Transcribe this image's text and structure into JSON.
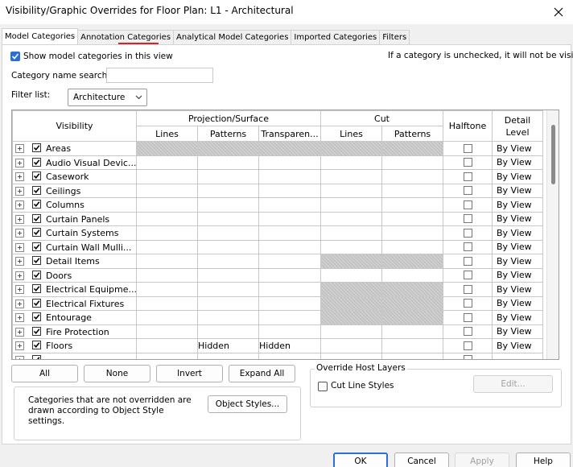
{
  "window": {
    "title": "Visibility/Graphic Overrides for Floor Plan: L1 - Architectural"
  },
  "tabs": [
    {
      "label": "Model Categories",
      "active": true
    },
    {
      "label": "Annotation Categories",
      "active": false
    },
    {
      "label": "Analytical Model Categories",
      "active": false
    },
    {
      "label": "Imported Categories",
      "active": false
    },
    {
      "label": "Filters",
      "active": false
    }
  ],
  "options": {
    "show_model_label": "Show model categories in this view",
    "show_model_checked": true,
    "hint": "If a category is unchecked, it will not be visible.",
    "search_label": "Category name search:",
    "search_value": "",
    "filter_label": "Filter list:",
    "filter_value": "Architecture"
  },
  "grid": {
    "headers": {
      "visibility": "Visibility",
      "projection": "Projection/Surface",
      "cut": "Cut",
      "halftone": "Halftone",
      "detail_level": "Detail Level",
      "lines": "Lines",
      "patterns": "Patterns",
      "transparency": "Transparen...",
      "cut_lines": "Lines",
      "cut_patterns": "Patterns"
    },
    "rows": [
      {
        "name": "Areas",
        "checked": true,
        "proj_grey": true,
        "cut_grey": true,
        "pat1": "",
        "pat2": "",
        "detail": "By View"
      },
      {
        "name": "Audio Visual Devic...",
        "checked": true,
        "proj_grey": false,
        "cut_grey": false,
        "pat1": "",
        "pat2": "",
        "detail": "By View"
      },
      {
        "name": "Casework",
        "checked": true,
        "proj_grey": false,
        "cut_grey": false,
        "pat1": "",
        "pat2": "",
        "detail": "By View"
      },
      {
        "name": "Ceilings",
        "checked": true,
        "proj_grey": false,
        "cut_grey": false,
        "pat1": "",
        "pat2": "",
        "detail": "By View"
      },
      {
        "name": "Columns",
        "checked": true,
        "proj_grey": false,
        "cut_grey": false,
        "pat1": "",
        "pat2": "",
        "detail": "By View"
      },
      {
        "name": "Curtain Panels",
        "checked": true,
        "proj_grey": false,
        "cut_grey": false,
        "pat1": "",
        "pat2": "",
        "detail": "By View"
      },
      {
        "name": "Curtain Systems",
        "checked": true,
        "proj_grey": false,
        "cut_grey": false,
        "pat1": "",
        "pat2": "",
        "detail": "By View"
      },
      {
        "name": "Curtain Wall Mulli...",
        "checked": true,
        "proj_grey": false,
        "cut_grey": false,
        "pat1": "",
        "pat2": "",
        "detail": "By View"
      },
      {
        "name": "Detail Items",
        "checked": true,
        "proj_grey": false,
        "cut_grey": true,
        "pat1": "",
        "pat2": "",
        "detail": "By View"
      },
      {
        "name": "Doors",
        "checked": true,
        "proj_grey": false,
        "cut_grey": false,
        "pat1": "",
        "pat2": "",
        "detail": "By View"
      },
      {
        "name": "Electrical Equipme...",
        "checked": true,
        "proj_grey": false,
        "cut_grey": true,
        "pat1": "",
        "pat2": "",
        "detail": "By View"
      },
      {
        "name": "Electrical Fixtures",
        "checked": true,
        "proj_grey": false,
        "cut_grey": true,
        "pat1": "",
        "pat2": "",
        "detail": "By View"
      },
      {
        "name": "Entourage",
        "checked": true,
        "proj_grey": false,
        "cut_grey": true,
        "pat1": "",
        "pat2": "",
        "detail": "By View"
      },
      {
        "name": "Fire Protection",
        "checked": true,
        "proj_grey": false,
        "cut_grey": false,
        "pat1": "",
        "pat2": "",
        "detail": "By View"
      },
      {
        "name": "Floors",
        "checked": true,
        "proj_grey": false,
        "cut_grey": false,
        "pat1": "Hidden",
        "pat2": "Hidden",
        "detail": "By View"
      },
      {
        "name": "",
        "checked": true,
        "proj_grey": false,
        "cut_grey": false,
        "pat1": "",
        "pat2": "",
        "detail": ""
      }
    ]
  },
  "actions": {
    "all": "All",
    "none": "None",
    "invert": "Invert",
    "expand_all": "Expand All",
    "object_styles_note": "Categories that are not overridden are drawn according to Object Style settings.",
    "object_styles": "Object Styles..."
  },
  "override_host": {
    "title": "Override Host Layers",
    "cut_line_styles": "Cut Line Styles",
    "cut_line_checked": false,
    "edit": "Edit..."
  },
  "footer": {
    "ok": "OK",
    "cancel": "Cancel",
    "apply": "Apply",
    "help": "Help"
  },
  "colors": {
    "accent": "#2a6fd6",
    "underline": "#e02020",
    "grey_cell": "#c8c8c8"
  }
}
